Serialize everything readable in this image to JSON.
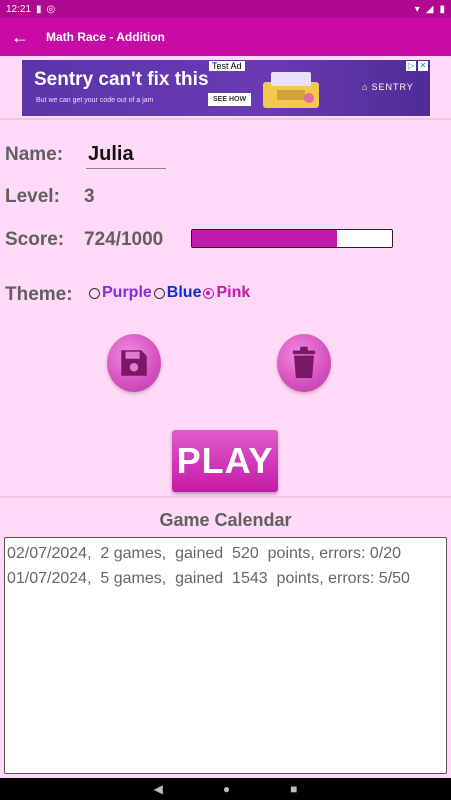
{
  "status_bar": {
    "time": "12:21"
  },
  "app_bar": {
    "back_icon": "arrow-left-icon",
    "title": "Math Race - Addition"
  },
  "ad": {
    "badge": "Test Ad",
    "headline": "Sentry can't fix this",
    "subline": "But we can get your code out of a jam",
    "cta": "SEE HOW",
    "brand": "SENTRY"
  },
  "form": {
    "name_label": "Name:",
    "name_value": "Julia",
    "level_label": "Level:",
    "level_value": "3",
    "score_label": "Score:",
    "score_value": "724/1000",
    "score_progress": 0.724,
    "theme_label": "Theme:",
    "themes": [
      {
        "label": "Purple",
        "color": "#8a2be2",
        "selected": false
      },
      {
        "label": "Blue",
        "color": "#0b2fd1",
        "selected": false
      },
      {
        "label": "Pink",
        "color": "#c21aae",
        "selected": true
      }
    ]
  },
  "actions": {
    "save_icon": "floppy-disk-icon",
    "delete_icon": "trash-icon",
    "play_label": "PLAY"
  },
  "calendar": {
    "title": "Game Calendar",
    "rows": [
      "02/07/2024,  2 games,  gained  520  points, errors: 0/20",
      "01/07/2024,  5 games,  gained  1543  points, errors: 5/50"
    ]
  },
  "colors": {
    "accent": "#c80aa6",
    "background": "#ffd9f6"
  }
}
